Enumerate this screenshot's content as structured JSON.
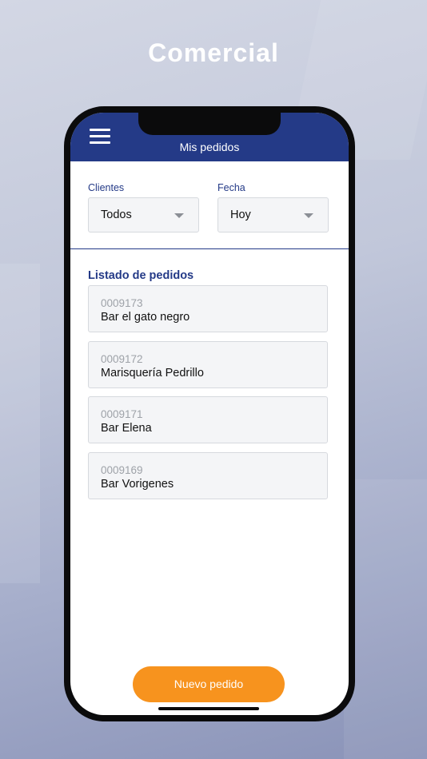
{
  "page": {
    "title": "Comercial"
  },
  "appbar": {
    "title": "Mis pedidos"
  },
  "filters": {
    "clients": {
      "label": "Clientes",
      "value": "Todos"
    },
    "date": {
      "label": "Fecha",
      "value": "Hoy"
    }
  },
  "list": {
    "title": "Listado de pedidos",
    "orders": [
      {
        "number": "0009173",
        "name": "Bar el gato negro"
      },
      {
        "number": "0009172",
        "name": "Marisquería Pedrillo"
      },
      {
        "number": "0009171",
        "name": "Bar Elena"
      },
      {
        "number": "0009169",
        "name": "Bar Vorigenes"
      }
    ]
  },
  "actions": {
    "new_order": "Nuevo pedido"
  },
  "colors": {
    "primary": "#243a87",
    "accent": "#f7931e"
  },
  "icons": {
    "menu": "hamburger-menu-icon",
    "dropdown": "chevron-down-icon"
  }
}
